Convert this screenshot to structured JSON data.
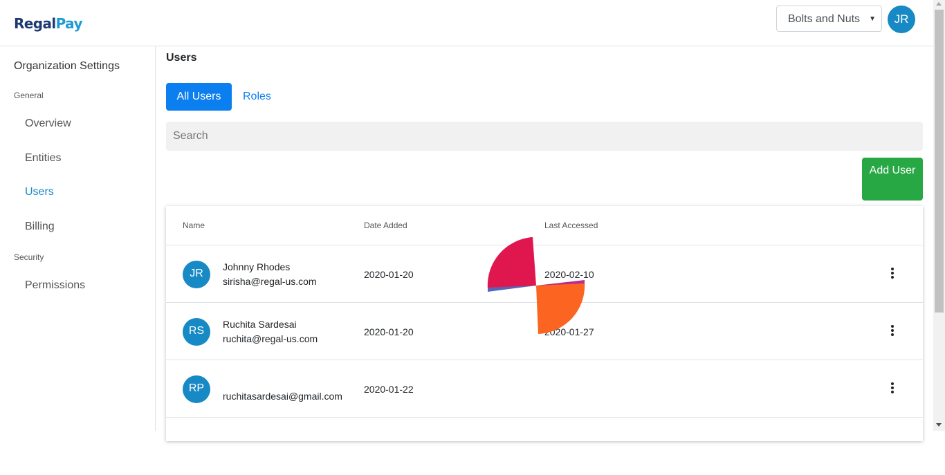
{
  "header": {
    "logo_part1": "Regal",
    "logo_part2": "Pay",
    "org_selected": "Bolts and Nuts",
    "user_initials": "JR"
  },
  "sidebar": {
    "title": "Organization Settings",
    "sections": [
      {
        "label": "General",
        "items": [
          "Overview",
          "Entities",
          "Users",
          "Billing"
        ]
      },
      {
        "label": "Security",
        "items": [
          "Permissions"
        ]
      }
    ],
    "active_item": "Users"
  },
  "main": {
    "title": "Users",
    "tabs": [
      {
        "label": "All Users",
        "active": true
      },
      {
        "label": "Roles",
        "active": false
      }
    ],
    "search": {
      "placeholder": "Search",
      "value": ""
    },
    "add_user_label": "Add User"
  },
  "table": {
    "columns": [
      "Name",
      "Date Added",
      "Last Accessed"
    ],
    "rows": [
      {
        "initials": "JR",
        "name": "Johnny Rhodes",
        "email": "sirisha@regal-us.com",
        "date_added": "2020-01-20",
        "last_accessed": "2020-02-10"
      },
      {
        "initials": "RS",
        "name": "Ruchita Sardesai",
        "email": "ruchita@regal-us.com",
        "date_added": "2020-01-20",
        "last_accessed": "2020-01-27"
      },
      {
        "initials": "RP",
        "name": "",
        "email": "ruchitasardesai@gmail.com",
        "date_added": "2020-01-22",
        "last_accessed": ""
      }
    ]
  },
  "colors": {
    "brand_dark": "#1c3a70",
    "brand_light": "#1c9ad6",
    "primary": "#0b7ef0",
    "success": "#28a745",
    "avatar": "#1789c4",
    "spinner_pink": "#e0174f",
    "spinner_orange": "#fb6421"
  }
}
